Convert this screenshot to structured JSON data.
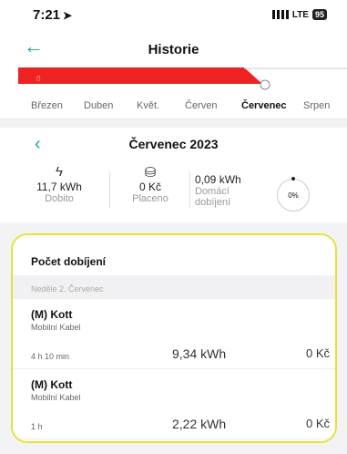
{
  "status": {
    "time": "7:21",
    "network": "LTE",
    "battery": "95"
  },
  "header": {
    "title": "Historie"
  },
  "chart_bar": {
    "label": "0"
  },
  "months": [
    "Březen",
    "Duben",
    "Květ.",
    "Červen",
    "Červenec",
    "Srpen"
  ],
  "period": {
    "title": "Červenec 2023",
    "stats": [
      {
        "icon": "bolt-icon",
        "value": "11,7 kWh",
        "label": "Dobito"
      },
      {
        "icon": "wallet-icon",
        "value": "0 Kč",
        "label": "Placeno"
      },
      {
        "value": "0,09 kWh",
        "label1": "Domácí",
        "label2": "dobíjení"
      }
    ],
    "home_percent": "0%"
  },
  "charges": {
    "title": "Počet dobíjení",
    "day": "Neděle 2. Červenec",
    "items": [
      {
        "name": "(M) Kott",
        "cable": "Mobilní Kabel",
        "duration": "4 h 10 min",
        "energy": "9,34 kWh",
        "cost": "0 Kč"
      },
      {
        "name": "(M) Kott",
        "cable": "Mobilní Kabel",
        "duration": "1 h",
        "energy": "2,22 kWh",
        "cost": "0 Kč"
      }
    ]
  }
}
